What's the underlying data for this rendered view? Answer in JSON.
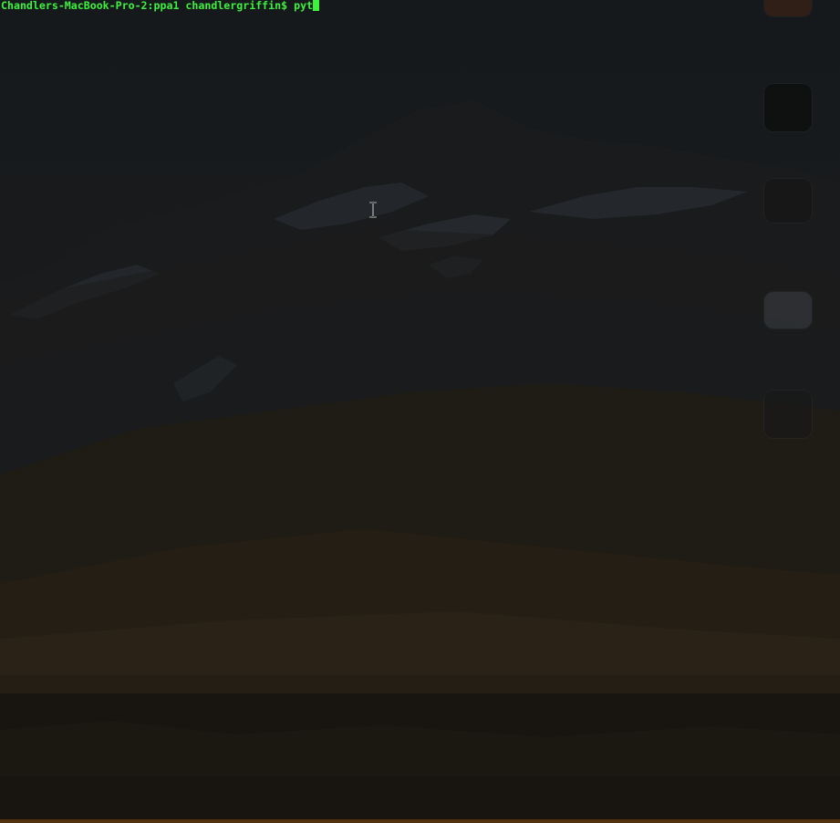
{
  "terminal": {
    "prompt": "Chandlers-MacBook-Pro-2:ppa1 chandlergriffin$ ",
    "command": "pyt"
  },
  "colors": {
    "terminal_text": "#3cf23c",
    "background": "#16191c"
  },
  "icons": {
    "text_cursor": "ibeam-cursor-icon"
  }
}
